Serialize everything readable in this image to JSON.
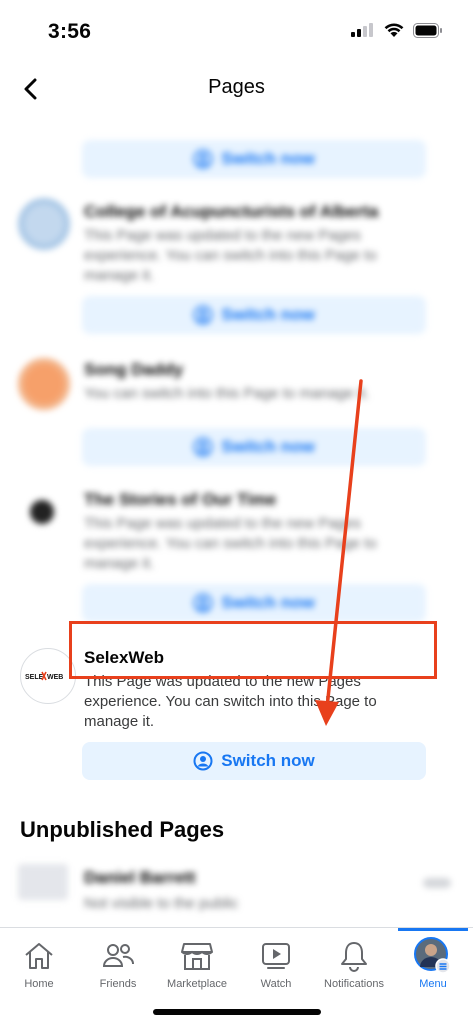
{
  "status_bar": {
    "time": "3:56"
  },
  "nav": {
    "title": "Pages",
    "back_icon": "chevron-left-icon"
  },
  "pages": [
    {
      "name": "",
      "description": "",
      "button_label": "Switch now",
      "avatar_color": "#c9dcef"
    },
    {
      "name": "College of Acupuncturists of Alberta",
      "description": "This Page was updated to the new Pages experience. You can switch into this Page to manage it.",
      "button_label": "Switch now",
      "avatar_color": "#b9d2ec"
    },
    {
      "name": "Song Daddy",
      "description": "You can switch into this Page to manage it.",
      "button_label": "Switch now",
      "avatar_color": "#f08a4b"
    },
    {
      "name": "The Stories of Our Time",
      "description": "This Page was updated to the new Pages experience. You can switch into this Page to manage it.",
      "button_label": "Switch now",
      "avatar_color": "#2a2a2a"
    },
    {
      "name": "SelexWeb",
      "description": "This Page was updated to the new Pages experience. You can switch into this Page to manage it.",
      "button_label": "Switch now",
      "logo_text": "SELEXWEB"
    }
  ],
  "unpublished": {
    "title": "Unpublished Pages",
    "item_name": "Daniel Barrett",
    "item_desc": "Not visible to the public"
  },
  "annotation": {
    "arrow_color": "#e8401c",
    "highlight_color": "#e8401c"
  },
  "tabs": [
    {
      "label": "Home",
      "icon": "home-icon"
    },
    {
      "label": "Friends",
      "icon": "friends-icon"
    },
    {
      "label": "Marketplace",
      "icon": "marketplace-icon"
    },
    {
      "label": "Watch",
      "icon": "watch-icon"
    },
    {
      "label": "Notifications",
      "icon": "bell-icon"
    },
    {
      "label": "Menu",
      "icon": "profile-avatar-icon",
      "active": true
    }
  ],
  "colors": {
    "accent": "#1877f2",
    "button_bg": "#e7f3ff",
    "secondary_text": "#65676b"
  }
}
